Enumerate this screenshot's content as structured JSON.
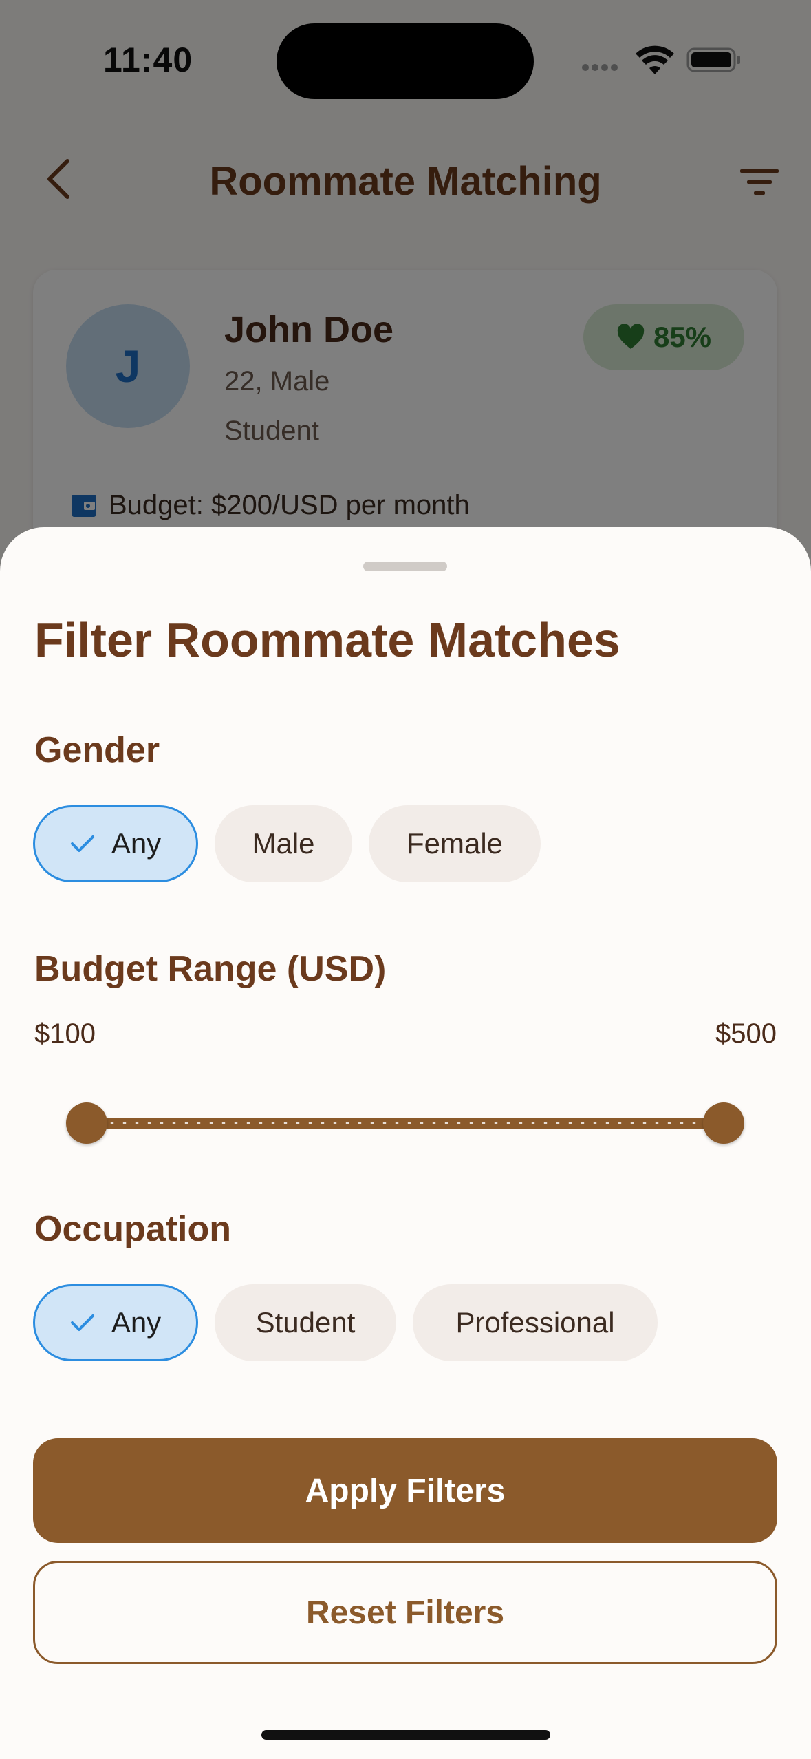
{
  "status_bar": {
    "time": "11:40"
  },
  "app_bar": {
    "title": "Roommate Matching",
    "back_icon": "chevron-left-icon",
    "filter_icon": "filter-icon"
  },
  "match_card": {
    "avatar_initial": "J",
    "name": "John Doe",
    "age_gender": "22, Male",
    "occupation": "Student",
    "match_percent": "85%",
    "budget_text": "Budget: $200/USD per month"
  },
  "filter_sheet": {
    "title": "Filter Roommate Matches",
    "gender": {
      "label": "Gender",
      "options": [
        "Any",
        "Male",
        "Female"
      ],
      "selected": "Any"
    },
    "budget": {
      "label": "Budget Range (USD)",
      "min_label": "$100",
      "max_label": "$500",
      "range_min": 100,
      "range_max": 500,
      "selected_min": 100,
      "selected_max": 500
    },
    "occupation": {
      "label": "Occupation",
      "options": [
        "Any",
        "Student",
        "Professional"
      ],
      "selected": "Any"
    },
    "apply_label": "Apply Filters",
    "reset_label": "Reset Filters"
  },
  "colors": {
    "brand_brown": "#8b5a2b",
    "title_brown": "#6b3a1d",
    "selected_chip_bg": "#d1e5f7",
    "selected_chip_border": "#2c8de0",
    "match_green": "#2f7d32"
  }
}
